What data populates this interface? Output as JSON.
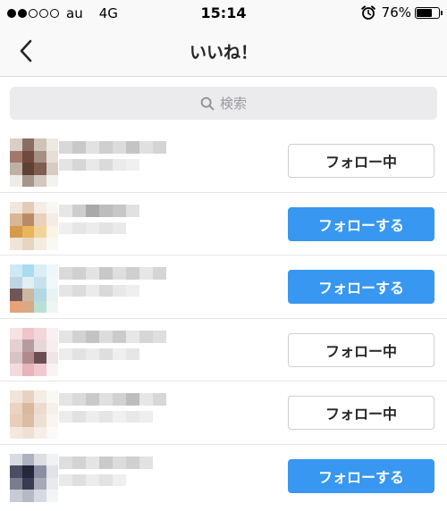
{
  "status_bar": {
    "carrier": "au",
    "network": "4G",
    "time": "15:14",
    "battery_text": "76%",
    "battery_level": 0.76,
    "signal_bars_filled": 2,
    "signal_bars_total": 5,
    "alarm_icon": "alarm-clock-icon"
  },
  "nav": {
    "back_icon": "chevron-left-icon",
    "title": "いいね！"
  },
  "search": {
    "icon": "search-icon",
    "placeholder": "検索"
  },
  "colors": {
    "follow_blue": "#3897f0",
    "following_border": "#cfcfcf",
    "search_bg": "#ebebee",
    "bar_bg": "#f9f9f9"
  },
  "users": [
    {
      "button_label": "フォロー中",
      "button_state": "following",
      "avatar_colors": [
        "#d9cfc6",
        "#8a6d62",
        "#cfc3b8",
        "#eee8e3",
        "#a27869",
        "#6f4a3d",
        "#a68f83",
        "#e8ded6",
        "#bfb0a6",
        "#5f4034",
        "#7f5d50",
        "#d6ccc4",
        "#efebe8",
        "#a5958d",
        "#d2c8c1",
        "#f4f1ee"
      ],
      "name_blur": [
        "#d8d8d8",
        "#c9c9c9",
        "#e2e2e2",
        "#cfcfcf",
        "#dcdcdc",
        "#c4c4c4",
        "#e0e0e0",
        "#d4d4d4"
      ],
      "sub_blur": [
        "#e4e4e4",
        "#d6d6d6",
        "#e9e9e9",
        "#dadada",
        "#ebebeb",
        "#f0f0f0"
      ]
    },
    {
      "button_label": "フォローする",
      "button_state": "follow",
      "avatar_colors": [
        "#f1e6dc",
        "#e3cbb6",
        "#f4ece5",
        "#faf6f2",
        "#d9b698",
        "#b88a66",
        "#e8d2bd",
        "#f5ede5",
        "#d59a4c",
        "#e9b55f",
        "#f2d49b",
        "#faf3e6",
        "#efe4d8",
        "#e7d5c1",
        "#f4ebe1",
        "#fbf8f4"
      ],
      "name_blur": [
        "#e6e6e6",
        "#cdcdcd",
        "#a9a9a9",
        "#bdbdbd",
        "#c7c7c7",
        "#e1e1e1"
      ],
      "sub_blur": [
        "#efefef",
        "#e6e6e6",
        "#ececec",
        "#e3e3e3",
        "#eaeaea"
      ]
    },
    {
      "button_label": "フォローする",
      "button_state": "follow",
      "avatar_colors": [
        "#cfe8f5",
        "#a9dcf0",
        "#d9eef7",
        "#eef7fb",
        "#bcd6e4",
        "#e2eef3",
        "#c9e1ec",
        "#f1f7fa",
        "#705658",
        "#cbb8a3",
        "#b3d7e3",
        "#e9f2f5",
        "#e8a27a",
        "#d9a985",
        "#b9e0d5",
        "#eef5f3"
      ],
      "name_blur": [
        "#dadada",
        "#d0d0d0",
        "#e3e3e3",
        "#c8c8c8",
        "#dedede",
        "#cfcfcf",
        "#e6e6e6",
        "#d5d5d5"
      ],
      "sub_blur": [
        "#e5e5e5",
        "#dcdcdc",
        "#ebebeb",
        "#d9d9d9",
        "#e8e8e8",
        "#efefef"
      ]
    },
    {
      "button_label": "フォロー中",
      "button_state": "following",
      "avatar_colors": [
        "#f6e1e3",
        "#efc5c9",
        "#f3d6d9",
        "#fbf0f1",
        "#e6cfd1",
        "#b79c9f",
        "#e8d7d9",
        "#f7eeef",
        "#d7c3c5",
        "#b18a8e",
        "#6c4e52",
        "#efe5e6",
        "#f2dadd",
        "#e6b4ba",
        "#f0c8cd",
        "#faf3f4"
      ],
      "name_blur": [
        "#e4e4e4",
        "#d2d2d2",
        "#c3c3c3",
        "#dcdcdc",
        "#cbcbcb",
        "#e7e7e7",
        "#d6d6d6",
        "#dfdfdf"
      ],
      "sub_blur": [
        "#ececec",
        "#e2e2e2",
        "#ebebeb",
        "#dedede",
        "#efefef",
        "#e6e6e6"
      ]
    },
    {
      "button_label": "フォロー中",
      "button_state": "following",
      "avatar_colors": [
        "#f2e4da",
        "#e7d2c2",
        "#f5ece5",
        "#fbf7f3",
        "#ead3c0",
        "#d8b89f",
        "#ecdccf",
        "#f7f0ea",
        "#e9cdb7",
        "#dcbda4",
        "#ede0d5",
        "#faf5f1",
        "#f4e8de",
        "#efe0d3",
        "#f6eee7",
        "#fcf9f6"
      ],
      "name_blur": [
        "#e4e4e4",
        "#dadada",
        "#c9c9c9",
        "#e0e0e0",
        "#d1d1d1",
        "#bdbdbd",
        "#e6e6e6",
        "#d7d7d7"
      ],
      "sub_blur": [
        "#ebebeb",
        "#e2e2e2",
        "#ededed",
        "#e5e5e5",
        "#f0f0f0",
        "#e8e8e8",
        "#eeeeee"
      ]
    },
    {
      "button_label": "フォローする",
      "button_state": "follow",
      "avatar_colors": [
        "#d9dbe2",
        "#aeb1bf",
        "#dcdee4",
        "#f1f2f4",
        "#4a4d63",
        "#24263a",
        "#8a8ea3",
        "#e2e3e8",
        "#7a7d90",
        "#393b52",
        "#a6a9b8",
        "#e9eaee",
        "#c8cad4",
        "#b7bac6",
        "#d8dae1",
        "#f3f4f6"
      ],
      "name_blur": [
        "#dedede",
        "#d3d3d3",
        "#e5e5e5",
        "#cacaca",
        "#dcdcdc",
        "#d0d0d0",
        "#e2e2e2"
      ],
      "sub_blur": [
        "#e9e9e9",
        "#dfdfdf",
        "#ececec",
        "#e3e3e3",
        "#efefef"
      ]
    }
  ]
}
